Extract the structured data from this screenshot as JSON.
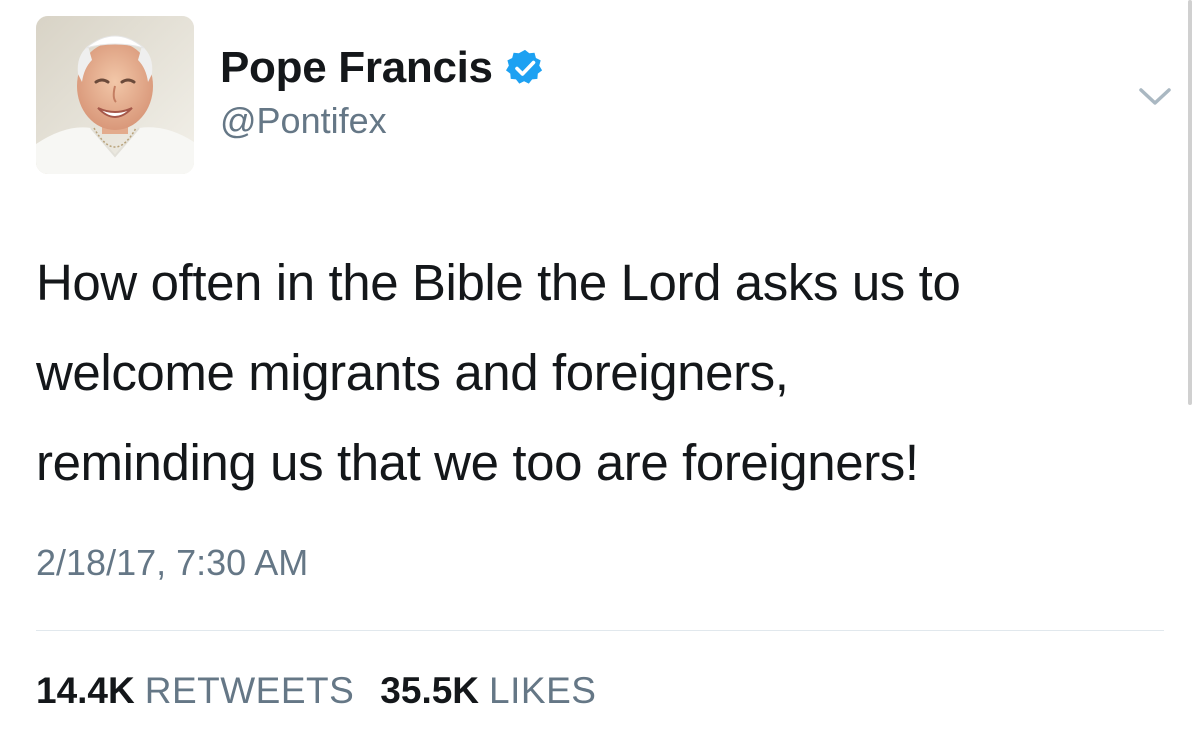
{
  "user": {
    "display_name": "Pope Francis",
    "handle": "@Pontifex",
    "verified": true,
    "avatar_icon": "profile-photo"
  },
  "tweet": {
    "lines": [
      "How often in the Bible the Lord asks us to",
      "welcome migrants and foreigners,",
      "reminding us that we too are foreigners!"
    ],
    "timestamp": "2/18/17, 7:30 AM"
  },
  "stats": {
    "retweets_count": "14.4K",
    "retweets_label": "RETWEETS",
    "likes_count": "35.5K",
    "likes_label": "LIKES"
  },
  "icons": {
    "verified": "verified-badge-icon",
    "menu": "chevron-down-icon"
  },
  "colors": {
    "text_primary": "#14171a",
    "text_secondary": "#657786",
    "verified_blue": "#1da1f2",
    "divider": "#e1e8ed"
  }
}
